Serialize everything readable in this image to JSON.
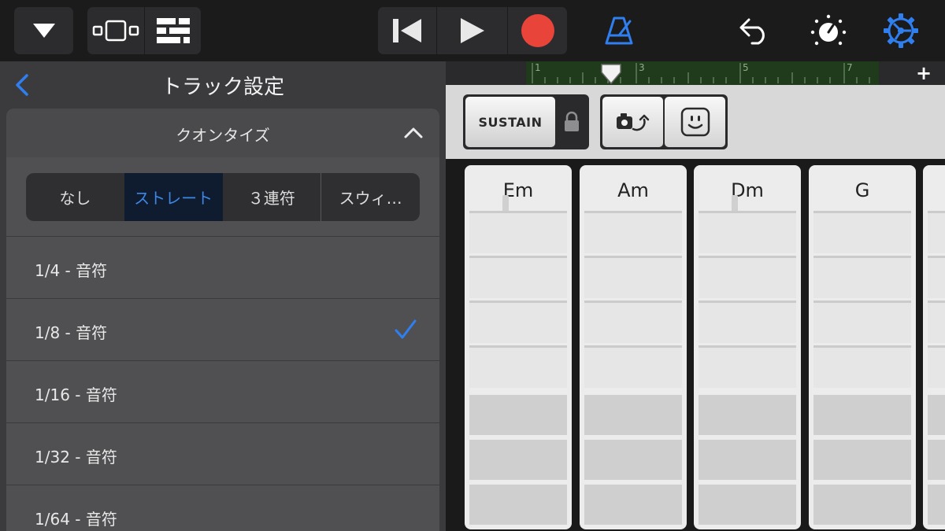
{
  "toolbar": {
    "icons": [
      "triangle-down-icon",
      "tracks-view-icon",
      "mixer-icon",
      "rewind-icon",
      "play-icon",
      "record-icon",
      "metronome-icon",
      "undo-icon",
      "master-effects-icon",
      "settings-icon"
    ],
    "record_color": "#e8443a",
    "accent_color": "#2f7ff0"
  },
  "panel": {
    "title": "トラック設定",
    "section": {
      "title": "クオンタイズ",
      "segments": [
        "なし",
        "ストレート",
        "３連符",
        "スウィ…"
      ],
      "selected_segment": "ストレート",
      "options": [
        {
          "label": "1/4 - 音符",
          "checked": false
        },
        {
          "label": "1/8 - 音符",
          "checked": true
        },
        {
          "label": "1/16 - 音符",
          "checked": false
        },
        {
          "label": "1/32 - 音符",
          "checked": false
        },
        {
          "label": "1/64 - 音符",
          "checked": false
        }
      ]
    }
  },
  "ruler": {
    "bars": [
      "1",
      "3",
      "5",
      "7"
    ],
    "add_label": "+"
  },
  "controls": {
    "sustain_label": "SUSTAIN",
    "icons": [
      "lock-icon",
      "autoplay-icon",
      "smiley-icon"
    ]
  },
  "chords": [
    "Em",
    "Am",
    "Dm",
    "G"
  ]
}
